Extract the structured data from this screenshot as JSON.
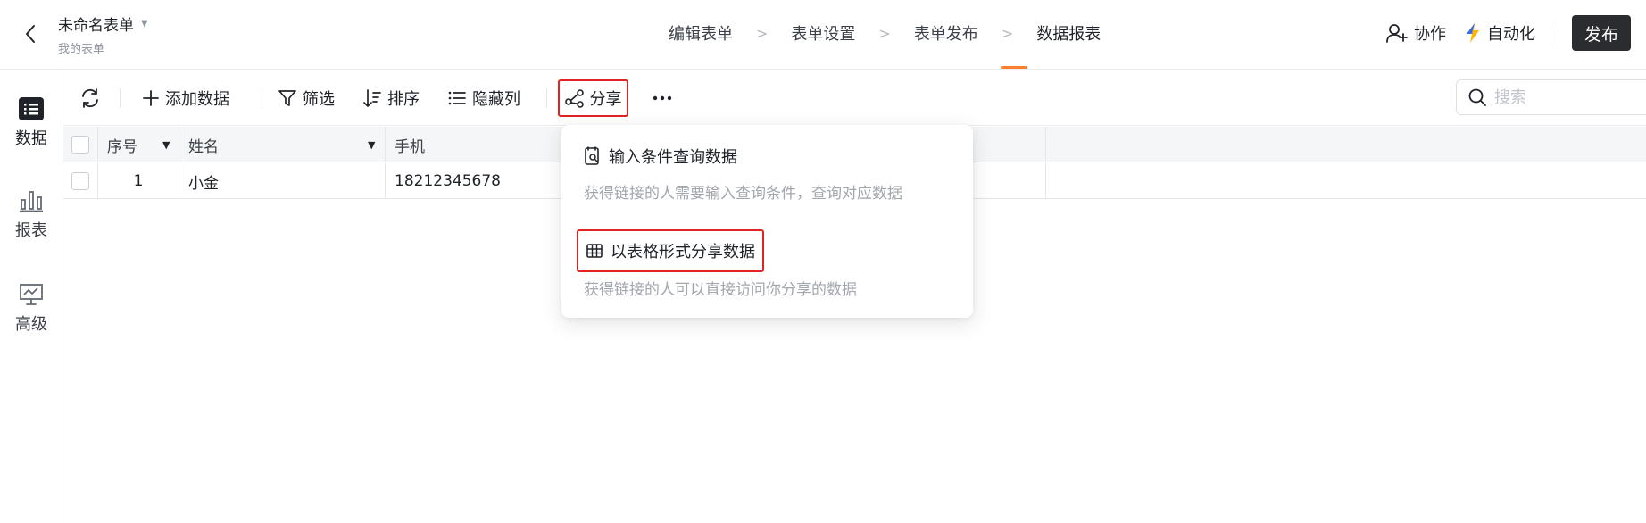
{
  "header": {
    "form_title": "未命名表单",
    "form_subtitle": "我的表单",
    "steps": [
      {
        "label": "编辑表单"
      },
      {
        "label": "表单设置"
      },
      {
        "label": "表单发布"
      },
      {
        "label": "数据报表"
      }
    ],
    "collab_label": "协作",
    "automate_label": "自动化",
    "publish_label": "发布"
  },
  "sidebar": {
    "items": [
      {
        "label": "数据",
        "icon": "list-icon"
      },
      {
        "label": "报表",
        "icon": "bar-chart-icon"
      },
      {
        "label": "高级",
        "icon": "presentation-icon"
      }
    ]
  },
  "toolbar": {
    "add_label": "添加数据",
    "filter_label": "筛选",
    "sort_label": "排序",
    "hide_label": "隐藏列",
    "share_label": "分享",
    "search_placeholder": "搜索"
  },
  "table": {
    "columns": [
      "序号",
      "姓名",
      "手机"
    ],
    "rows": [
      {
        "index": "1",
        "name": "小金",
        "phone": "18212345678"
      }
    ]
  },
  "share_menu": {
    "query_title": "输入条件查询数据",
    "query_desc": "获得链接的人需要输入查询条件，查询对应数据",
    "table_title": "以表格形式分享数据",
    "table_desc": "获得链接的人可以直接访问你分享的数据"
  },
  "colors": {
    "accent": "#ff7d2e",
    "highlight_border": "#e02424",
    "publish_bg": "#2b2c30"
  }
}
